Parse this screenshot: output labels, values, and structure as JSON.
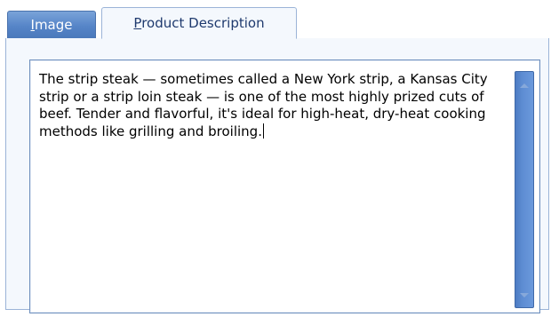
{
  "tabs": [
    {
      "label_underlined_char": "I",
      "label_rest": "mage",
      "active": false
    },
    {
      "label_underlined_char": "P",
      "label_rest": "roduct Description",
      "active": true
    }
  ],
  "memo": {
    "text": "The strip steak — sometimes called a New York strip, a Kansas City strip or a strip loin steak — is one of the most highly prized cuts of beef. Tender and flavorful, it's ideal for high-heat, dry-heat cooking methods like grilling and broiling."
  },
  "scrollbar": {
    "up_icon": "chevron-up-icon",
    "down_icon": "chevron-down-icon"
  },
  "colors": {
    "inactive_tab": "#5584c7",
    "active_tab_bg": "#f4f8fd",
    "scrollbar": "#5e8dd3",
    "border": "#9bb4d8"
  }
}
